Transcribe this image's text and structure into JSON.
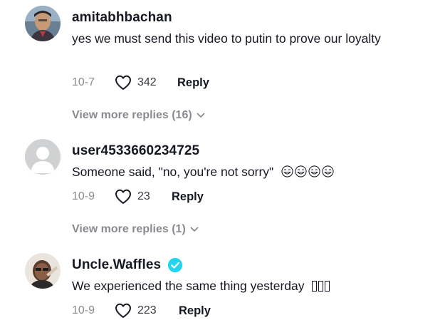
{
  "comments": [
    {
      "username": "amitabhbachan",
      "text": "yes we must send this video to putin to prove our loyalty",
      "date": "10-7",
      "likes": "342",
      "reply_label": "Reply",
      "view_more": "View more replies (16)",
      "verified": false,
      "avatar_icon": "profile-photo"
    },
    {
      "username": "user4533660234725",
      "text": "Someone said, \"no, you're not sorry\"",
      "text_trailing_emoji": [
        "sweat-smile-emoji",
        "sweat-smile-emoji",
        "sweat-smile-emoji",
        "sweat-smile-emoji"
      ],
      "date": "10-9",
      "likes": "23",
      "reply_label": "Reply",
      "view_more": "View more replies (1)",
      "verified": false,
      "avatar_icon": "default-avatar-icon"
    },
    {
      "username": "Uncle.Waffles",
      "text": "We experienced the same thing yesterday",
      "date": "10-9",
      "likes": "223",
      "reply_label": "Reply",
      "verified": true,
      "avatar_icon": "profile-photo"
    }
  ],
  "colors": {
    "primary_text": "#161823",
    "secondary_text": "#8a8b91",
    "verified_badge": "#20d5ec",
    "default_avatar_bg": "#d0d1d3"
  }
}
